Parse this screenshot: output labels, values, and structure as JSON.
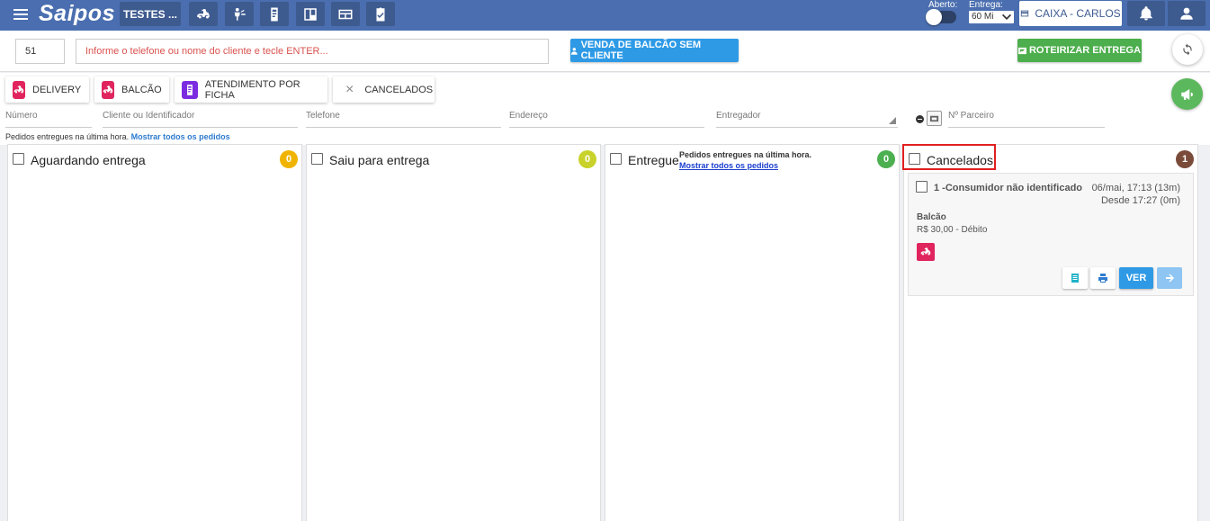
{
  "header": {
    "logo": "Saipos",
    "store": "TESTES ...",
    "aberto_label": "Aberto:",
    "entrega_label": "Entrega:",
    "entrega_value": "60 Mi",
    "caixa_label": "CAIXA - CARLOS",
    "icons": [
      "delivery-icon",
      "waiter-icon",
      "ticket-icon",
      "kanban-icon",
      "counter-icon",
      "checklist-icon"
    ]
  },
  "search": {
    "order_number": "51",
    "client_placeholder": "Informe o telefone ou nome do cliente e tecle ENTER...",
    "counter_sale_label": "VENDA DE BALCÃO SEM CLIENTE",
    "route_label": "ROTEIRIZAR ENTREGA"
  },
  "chips": {
    "delivery": "DELIVERY",
    "balcao": "BALCÃO",
    "ficha": "ATENDIMENTO POR FICHA",
    "cancelados": "CANCELADOS"
  },
  "filters": {
    "numero": "Número",
    "cliente": "Cliente ou Identificador",
    "telefone": "Telefone",
    "endereco": "Endereço",
    "entregador": "Entregador",
    "parceiro": "Nº Parceiro"
  },
  "hint": {
    "text": "Pedidos entregues na última hora.",
    "link": "Mostrar todos os pedidos"
  },
  "columns": [
    {
      "title": "Aguardando entrega",
      "count": "0",
      "color": "#f0b400"
    },
    {
      "title": "Saiu para entrega",
      "count": "0",
      "color": "#c8d22a"
    },
    {
      "title": "Entregue",
      "count": "0",
      "color": "#4caf50",
      "note": "Pedidos entregues na última hora.",
      "note_link": "Mostrar todos os pedidos"
    },
    {
      "title": "Cancelados",
      "count": "1",
      "color": "#7b4b3a"
    }
  ],
  "order": {
    "title": "1 -Consumidor não identificado",
    "date": "06/mai, 17:13 (13m)",
    "since": "Desde 17:27 (0m)",
    "type": "Balcão",
    "price": "R$ 30,00 - Débito",
    "ver_label": "VER"
  },
  "colors": {
    "topbar": "#4a6eaf",
    "primary_blue": "#2e9ae6",
    "green": "#4cae4c",
    "delivery_pink": "#e0245e",
    "ficha_purple": "#7b2ce0"
  }
}
